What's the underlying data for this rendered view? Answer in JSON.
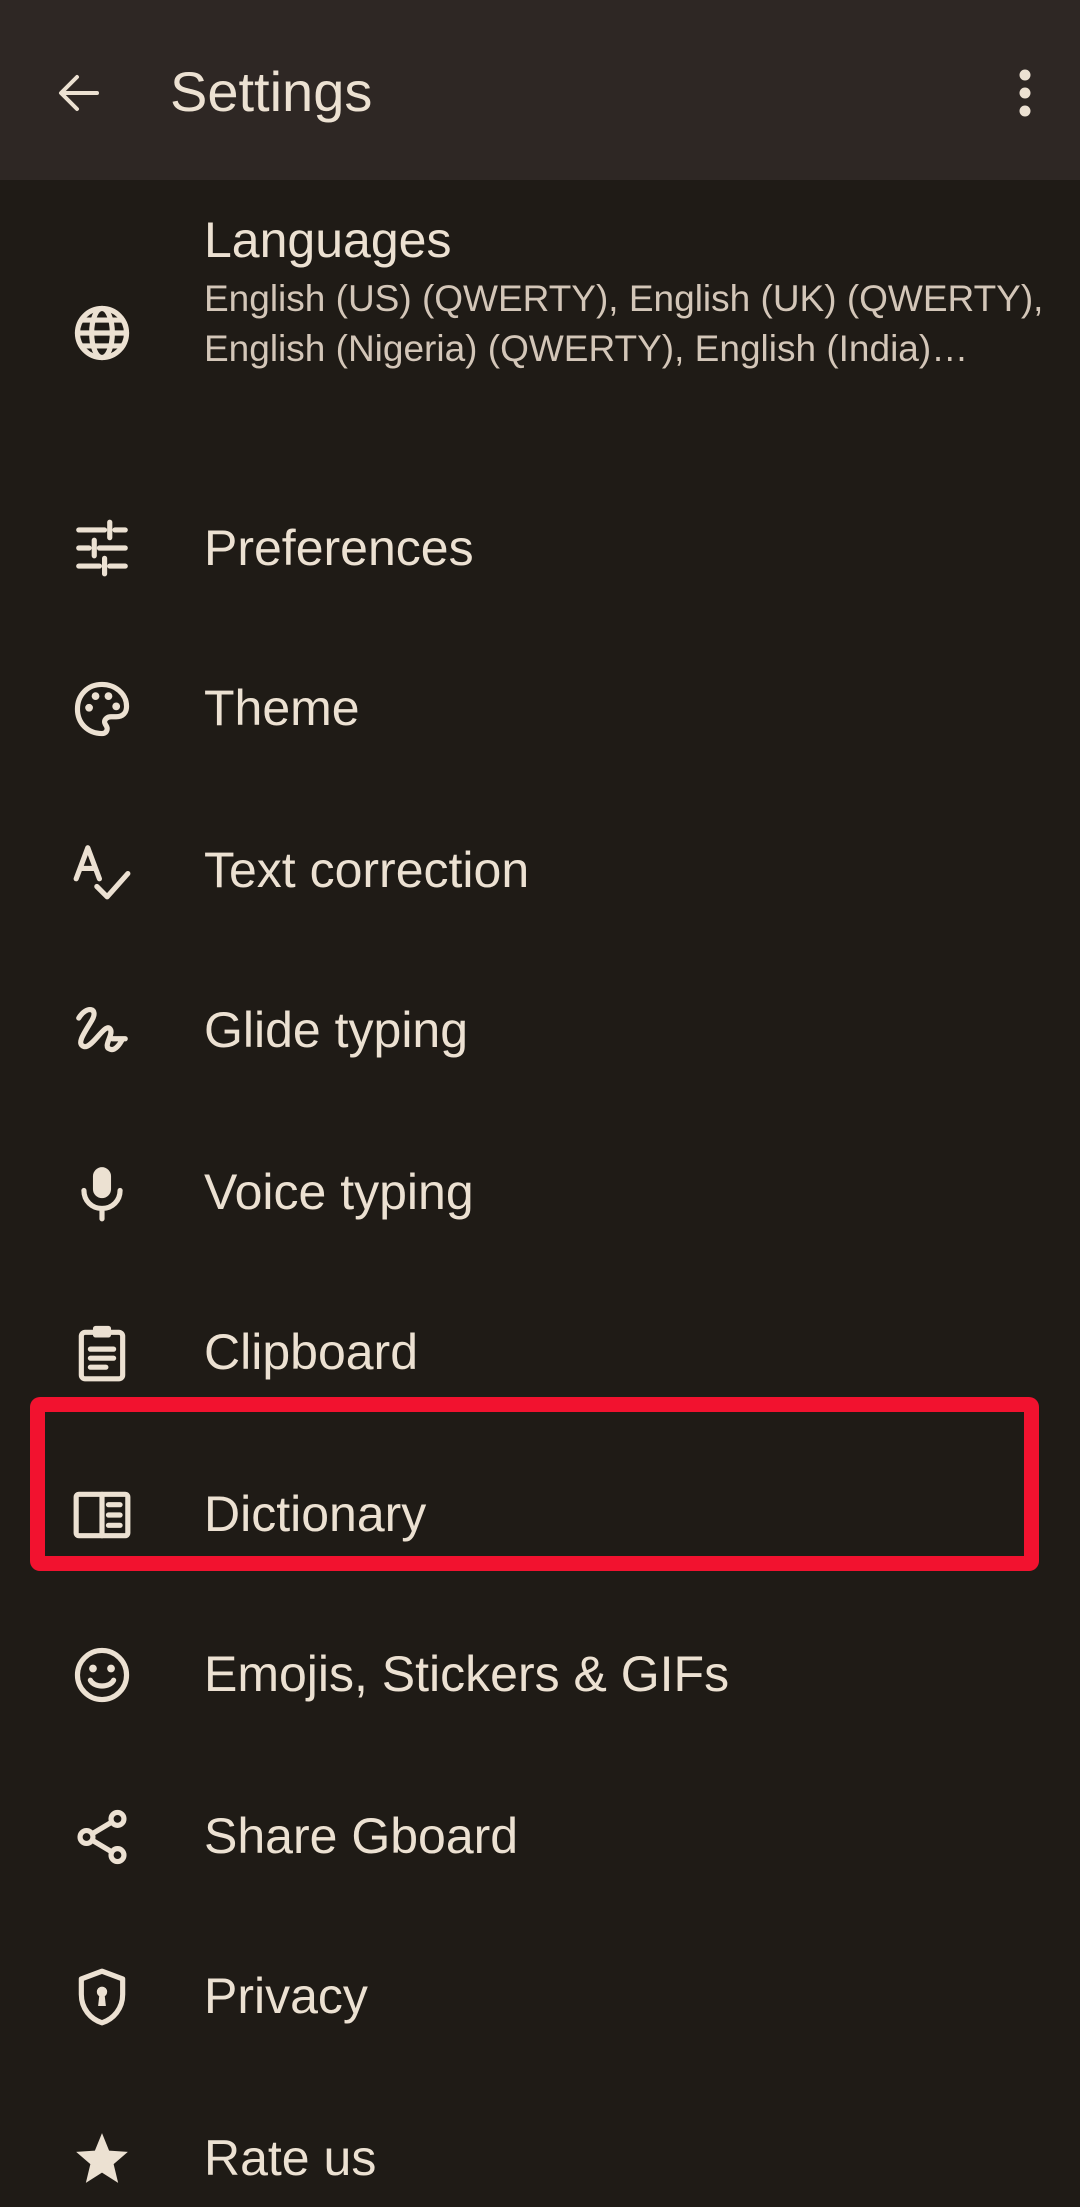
{
  "app_bar": {
    "title": "Settings",
    "back_icon": "arrow-back-icon",
    "more_icon": "more-vert-icon"
  },
  "items": [
    {
      "label": "Languages",
      "summary": "English (US) (QWERTY), English (UK) (QWERTY), English (Nigeria) (QWERTY), English (India) (QWERTY)",
      "icon": "globe-icon"
    },
    {
      "label": "Preferences",
      "icon": "tune-icon"
    },
    {
      "label": "Theme",
      "icon": "palette-icon"
    },
    {
      "label": "Text correction",
      "icon": "spellcheck-icon"
    },
    {
      "label": "Glide typing",
      "icon": "gesture-icon"
    },
    {
      "label": "Voice typing",
      "icon": "mic-icon"
    },
    {
      "label": "Clipboard",
      "icon": "clipboard-icon"
    },
    {
      "label": "Dictionary",
      "icon": "dictionary-icon"
    },
    {
      "label": "Emojis, Stickers & GIFs",
      "icon": "smiley-icon"
    },
    {
      "label": "Share Gboard",
      "icon": "share-icon"
    },
    {
      "label": "Privacy",
      "icon": "shield-icon"
    },
    {
      "label": "Rate us",
      "icon": "star-icon"
    }
  ],
  "highlight": {
    "target": "Dictionary",
    "color": "#f2122f"
  },
  "colors": {
    "background": "#1f1b16",
    "app_bar": "#2e2724",
    "text": "#ece1d2"
  }
}
